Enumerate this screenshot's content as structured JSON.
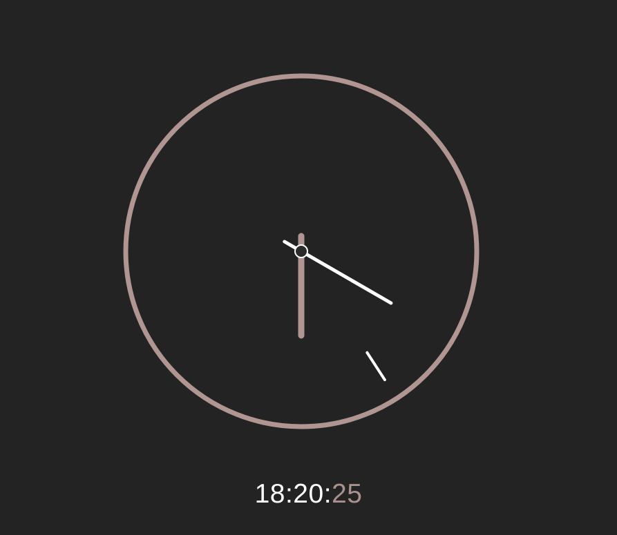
{
  "time": {
    "hours": 18,
    "minutes": 20,
    "seconds": 25
  },
  "digital": {
    "hours_text": "18",
    "sep1": ":",
    "minutes_text": "20",
    "sep2": ":",
    "seconds_text": "25"
  },
  "colors": {
    "background": "#232323",
    "face_ring": "#b09591",
    "hour_hand": "#b09591",
    "minute_hand": "#ffffff",
    "second_hand": "#ffffff",
    "center_dot": "#2b2b2b",
    "digital_main": "#ffffff",
    "digital_seconds": "#a8928e"
  }
}
